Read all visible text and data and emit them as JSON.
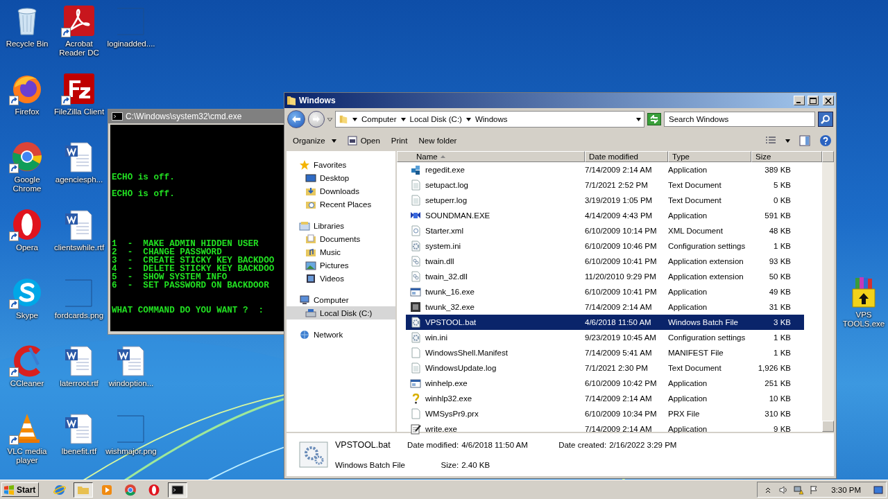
{
  "desktop": {
    "icons": [
      {
        "label": "Recycle Bin",
        "kind": "recycle",
        "shortcut": false
      },
      {
        "label": "Acrobat Reader DC",
        "kind": "acrobat",
        "shortcut": true
      },
      {
        "label": "loginadded....",
        "kind": "image",
        "shortcut": false
      },
      {
        "label": "Firefox",
        "kind": "firefox",
        "shortcut": true
      },
      {
        "label": "FileZilla Client",
        "kind": "filezilla",
        "shortcut": true
      },
      {
        "label": "Google Chrome",
        "kind": "chrome",
        "shortcut": true
      },
      {
        "label": "agenciesph...",
        "kind": "word",
        "shortcut": false
      },
      {
        "label": "Opera",
        "kind": "opera",
        "shortcut": true
      },
      {
        "label": "clientswhile.rtf",
        "kind": "word",
        "shortcut": false
      },
      {
        "label": "Skype",
        "kind": "skype",
        "shortcut": true
      },
      {
        "label": "fordcards.png",
        "kind": "image",
        "shortcut": false
      },
      {
        "label": "CCleaner",
        "kind": "ccleaner",
        "shortcut": true
      },
      {
        "label": "laterroot.rtf",
        "kind": "word",
        "shortcut": false
      },
      {
        "label": "windoption...",
        "kind": "word",
        "shortcut": false
      },
      {
        "label": "VLC media player",
        "kind": "vlc",
        "shortcut": true
      },
      {
        "label": "lbenefit.rtf",
        "kind": "word",
        "shortcut": false
      },
      {
        "label": "wishmajor.png",
        "kind": "image",
        "shortcut": false
      },
      {
        "label": "VPS TOOLS.exe",
        "kind": "archive",
        "shortcut": false
      }
    ]
  },
  "cmd_window": {
    "title": "C:\\Windows\\system32\\cmd.exe",
    "blocks": [
      [
        "ECHO is off."
      ],
      [
        "ECHO is off."
      ],
      [
        "1  -  MAKE ADMIN HIDDEN USER",
        "2  -  CHANGE PASSWORD",
        "3  -  CREATE STICKY KEY BACKDOO",
        "4  -  DELETE STICKY KEY BACKDOO",
        "5  -  SHOW SYSTEM INFO",
        "6  -  SET PASSWORD ON BACKDOOR"
      ],
      [
        "WHAT COMMAND DO YOU WANT ?  :"
      ]
    ]
  },
  "explorer": {
    "title": "Windows",
    "breadcrumb": [
      "Computer",
      "Local Disk (C:)",
      "Windows"
    ],
    "search": {
      "placeholder": "Search Windows"
    },
    "toolbar": [
      {
        "label": "Organize",
        "kind": "menu"
      },
      {
        "label": "Open",
        "kind": "open"
      },
      {
        "label": "Print",
        "kind": "plain"
      },
      {
        "label": "New folder",
        "kind": "plain"
      }
    ],
    "nav": [
      {
        "label": "Favorites",
        "kind": "star",
        "selected": false,
        "children": [
          {
            "label": "Desktop",
            "kind": "desktop",
            "selected": false
          },
          {
            "label": "Downloads",
            "kind": "downloads",
            "selected": false
          },
          {
            "label": "Recent Places",
            "kind": "recent",
            "selected": false
          }
        ]
      },
      {
        "label": "Libraries",
        "kind": "library",
        "selected": false,
        "children": [
          {
            "label": "Documents",
            "kind": "documents",
            "selected": false
          },
          {
            "label": "Music",
            "kind": "music",
            "selected": false
          },
          {
            "label": "Pictures",
            "kind": "pictures",
            "selected": false
          },
          {
            "label": "Videos",
            "kind": "videos",
            "selected": false
          }
        ]
      },
      {
        "label": "Computer",
        "kind": "computer",
        "selected": false,
        "children": [
          {
            "label": "Local Disk (C:)",
            "kind": "disk",
            "selected": true
          }
        ]
      },
      {
        "label": "Network",
        "kind": "network",
        "selected": false
      }
    ],
    "columns": [
      {
        "label": "Name",
        "sorted": true
      },
      {
        "label": "Date modified",
        "sorted": false
      },
      {
        "label": "Type",
        "sorted": false
      },
      {
        "label": "Size",
        "sorted": false
      }
    ],
    "rows": [
      {
        "name": "regedit.exe",
        "date": "7/14/2009 2:14 AM",
        "type": "Application",
        "size": "389 KB",
        "kind": "regedit",
        "selected": false
      },
      {
        "name": "setupact.log",
        "date": "7/1/2021 2:52 PM",
        "type": "Text Document",
        "size": "5 KB",
        "kind": "text",
        "selected": false
      },
      {
        "name": "setuperr.log",
        "date": "3/19/2019 1:05 PM",
        "type": "Text Document",
        "size": "0 KB",
        "kind": "text",
        "selected": false
      },
      {
        "name": "SOUNDMAN.EXE",
        "date": "4/14/2009 4:43 PM",
        "type": "Application",
        "size": "591 KB",
        "kind": "sound",
        "selected": false
      },
      {
        "name": "Starter.xml",
        "date": "6/10/2009 10:14 PM",
        "type": "XML Document",
        "size": "48 KB",
        "kind": "xml",
        "selected": false
      },
      {
        "name": "system.ini",
        "date": "6/10/2009 10:46 PM",
        "type": "Configuration settings",
        "size": "1 KB",
        "kind": "gear",
        "selected": false
      },
      {
        "name": "twain.dll",
        "date": "6/10/2009 10:41 PM",
        "type": "Application extension",
        "size": "93 KB",
        "kind": "dll",
        "selected": false
      },
      {
        "name": "twain_32.dll",
        "date": "11/20/2010 9:29 PM",
        "type": "Application extension",
        "size": "50 KB",
        "kind": "dll",
        "selected": false
      },
      {
        "name": "twunk_16.exe",
        "date": "6/10/2009 10:41 PM",
        "type": "Application",
        "size": "49 KB",
        "kind": "app",
        "selected": false
      },
      {
        "name": "twunk_32.exe",
        "date": "7/14/2009 2:14 AM",
        "type": "Application",
        "size": "31 KB",
        "kind": "scanner",
        "selected": false
      },
      {
        "name": "VPSTOOL.bat",
        "date": "4/6/2018 11:50 AM",
        "type": "Windows Batch File",
        "size": "3 KB",
        "kind": "gear",
        "selected": true
      },
      {
        "name": "win.ini",
        "date": "9/23/2019 10:45 AM",
        "type": "Configuration settings",
        "size": "1 KB",
        "kind": "gear",
        "selected": false
      },
      {
        "name": "WindowsShell.Manifest",
        "date": "7/14/2009 5:41 AM",
        "type": "MANIFEST File",
        "size": "1 KB",
        "kind": "blank",
        "selected": false
      },
      {
        "name": "WindowsUpdate.log",
        "date": "7/1/2021 2:30 PM",
        "type": "Text Document",
        "size": "1,926 KB",
        "kind": "text",
        "selected": false
      },
      {
        "name": "winhelp.exe",
        "date": "6/10/2009 10:42 PM",
        "type": "Application",
        "size": "251 KB",
        "kind": "app",
        "selected": false
      },
      {
        "name": "winhlp32.exe",
        "date": "7/14/2009 2:14 AM",
        "type": "Application",
        "size": "10 KB",
        "kind": "help",
        "selected": false
      },
      {
        "name": "WMSysPr9.prx",
        "date": "6/10/2009 10:34 PM",
        "type": "PRX File",
        "size": "310 KB",
        "kind": "blank",
        "selected": false
      },
      {
        "name": "write.exe",
        "date": "7/14/2009 2:14 AM",
        "type": "Application",
        "size": "9 KB",
        "kind": "write",
        "selected": false
      }
    ],
    "details": {
      "name": "VPSTOOL.bat",
      "type": "Windows Batch File",
      "fields": [
        {
          "label": "Date modified:",
          "value": "4/6/2018 11:50 AM"
        },
        {
          "label": "Date created:",
          "value": "2/16/2022 3:29 PM"
        },
        {
          "label": "Size:",
          "value": "2.40 KB"
        }
      ]
    }
  },
  "taskbar": {
    "start": "Start",
    "apps": [
      {
        "kind": "ie",
        "active": false
      },
      {
        "kind": "folder",
        "active": true
      },
      {
        "kind": "media",
        "active": false
      },
      {
        "kind": "chrome",
        "active": false
      },
      {
        "kind": "opera",
        "active": false
      },
      {
        "kind": "cmd",
        "active": true
      }
    ],
    "time": "3:30 PM"
  }
}
